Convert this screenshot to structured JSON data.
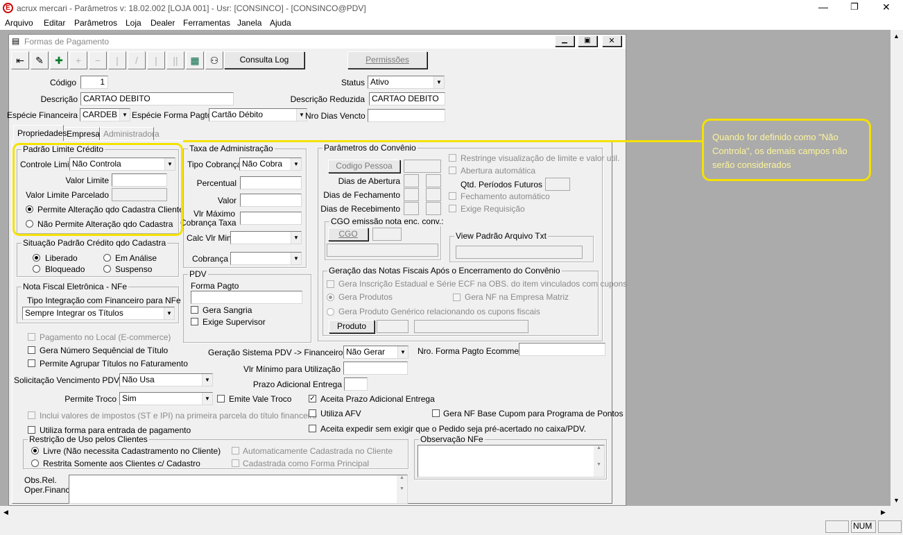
{
  "app": {
    "title": "acrux mercari - Parâmetros  v: 18.02.002   [LOJA 001] - Usr: [CONSINCO] - [CONSINCO@PDV]",
    "logo": "E"
  },
  "menu": [
    "Arquivo",
    "Editar",
    "Parâmetros",
    "Loja",
    "Dealer",
    "Ferramentas",
    "Janela",
    "Ajuda"
  ],
  "window": {
    "title": "Formas de Pagamento"
  },
  "toolbar": {
    "consulta_log": "Consulta Log",
    "permissoes": "Permissões"
  },
  "header": {
    "codigo_label": "Código",
    "codigo": "1",
    "status_label": "Status",
    "status": "Ativo",
    "descricao_label": "Descrição",
    "descricao": "CARTAO DEBITO",
    "desc_reduzida_label": "Descrição Reduzida",
    "desc_reduzida": "CARTAO DEBITO",
    "especie_fin_label": "Espécie Financeira",
    "especie_fin": "CARDEB",
    "especie_forma_label": "Espécie Forma Pagto",
    "especie_forma": "Cartão Débito",
    "nro_dias_label": "Nro Dias Vencto",
    "nro_dias": ""
  },
  "tabs": [
    "Propriedades",
    "Empresas",
    "Administradora"
  ],
  "limite": {
    "title": "Padrão Limite Crédito",
    "controle_label": "Controle Limite",
    "controle": "Não Controla",
    "valor_label": "Valor Limite",
    "parcelado_label": "Valor Limite Parcelado",
    "permite": "Permite Alteração qdo Cadastra Cliente",
    "nao_permite": "Não Permite Alteração qdo Cadastra"
  },
  "situacao": {
    "title": "Situação Padrão Crédito qdo Cadastra",
    "liberado": "Liberado",
    "em_analise": "Em Análise",
    "bloqueado": "Bloqueado",
    "suspenso": "Suspenso"
  },
  "nfe": {
    "title": "Nota Fiscal Eletrônica - NFe",
    "tipo_label": "Tipo Integração com Financeiro para NFe",
    "tipo": "Sempre Integrar os Títulos"
  },
  "taxa": {
    "title": "Taxa de Administração",
    "tipo_label": "Tipo Cobrança",
    "tipo": "Não Cobra",
    "percentual_label": "Percentual",
    "valor_label": "Valor",
    "vlr_max_l1": "Vlr Máximo",
    "vlr_max_l2": "Cobrança Taxa",
    "calc_label": "Calc Vlr Min",
    "cobranca_label": "Cobrança"
  },
  "pdv": {
    "title": "PDV",
    "forma_label": "Forma Pagto",
    "sangria": "Gera Sangria",
    "supervisor": "Exige Supervisor"
  },
  "convenio": {
    "title": "Parâmetros do Convênio",
    "codigo_pessoa": "Codigo Pessoa",
    "dias_abertura": "Dias de Abertura",
    "dias_fechamento": "Dias de Fechamento",
    "dias_recebimento": "Dias de Recebimento",
    "restringe": "Restringe visualização de limite e valor util.",
    "abertura_auto": "Abertura automática",
    "qtd_label": "Qtd. Períodos Futuros",
    "fechamento_auto": "Fechamento automático",
    "exige_req": "Exige Requisição",
    "cgo_title": "CGO emissão nota enc. conv.:",
    "cgo_btn": "CGO",
    "view_title": "View Padrão Arquivo Txt",
    "geracao_title": "Geração das Notas Fiscais Após o Encerramento do Convênio",
    "gera_insc": "Gera Inscrição Estadual e Série ECF na OBS. do item vinculados com cupons",
    "gera_produtos": "Gera Produtos",
    "gera_nf_matriz": "Gera NF na Empresa Matriz",
    "gera_generico": "Gera Produto Genérico relacionando os cupons fiscais",
    "produto_btn": "Produto"
  },
  "bottom": {
    "pagamento_local": "Pagamento no Local (E-commerce)",
    "gera_numero": "Gera Número Sequêncial de Título",
    "permite_agrupar": "Permite Agrupar Títulos no Faturamento",
    "geracao_label": "Geração Sistema PDV -> Financeiro",
    "geracao": "Não Gerar",
    "nro_ecom_label": "Nro. Forma Pagto Ecommerce",
    "vlr_min_label": "Vlr Mínimo para Utilização",
    "prazo_label": "Prazo Adicional Entrega",
    "solic_label": "Solicitação Vencimento PDV",
    "solic": "Não Usa",
    "troco_label": "Permite Troco",
    "troco": "Sim",
    "vale_troco": "Emite Vale Troco",
    "aceita_prazo": "Aceita Prazo Adicional Entrega",
    "inclui_impostos": "Inclui valores de impostos (ST e IPI) na primeira parcela do título financeiro",
    "utiliza_afv": "Utiliza AFV",
    "gera_nf_cupom": "Gera NF Base Cupom para Programa de Pontos",
    "utiliza_entrada": "Utiliza forma para entrada de pagamento",
    "aceita_expedir": "Aceita expedir sem exigir que o Pedido seja pré-acertado no caixa/PDV."
  },
  "restricao": {
    "title": "Restrição de Uso pelos Clientes",
    "livre": "Livre (Não necessita Cadastramento no Cliente)",
    "restrita": "Restrita Somente aos Clientes c/ Cadastro",
    "auto_cad": "Automaticamente Cadastrada no Cliente",
    "cad_principal": "Cadastrada como Forma Principal"
  },
  "obs": {
    "title": "Observação NFe",
    "rel_l1": "Obs.Rel.",
    "rel_l2": "Oper.Financ."
  },
  "callout": {
    "text": "Quando for definido como \"Não Controla\", os demais campos não serão considerados",
    "color": "#f5e100"
  },
  "status_bar": {
    "num": "NUM"
  }
}
